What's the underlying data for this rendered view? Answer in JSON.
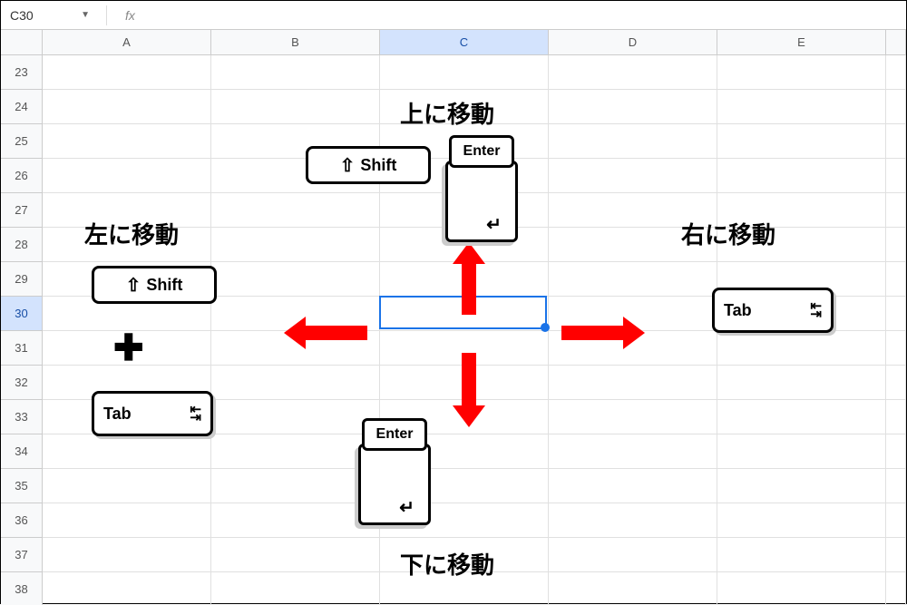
{
  "formula_bar": {
    "name_box": "C30",
    "fx": "fx"
  },
  "columns": [
    "A",
    "B",
    "C",
    "D",
    "E"
  ],
  "active_column_index": 2,
  "row_start": 23,
  "row_end": 38,
  "active_row": 30,
  "labels": {
    "up": "上に移動",
    "down": "下に移動",
    "left": "左に移動",
    "right": "右に移動"
  },
  "keys": {
    "shift": "Shift",
    "enter": "Enter",
    "tab": "Tab",
    "plus": "✚"
  }
}
